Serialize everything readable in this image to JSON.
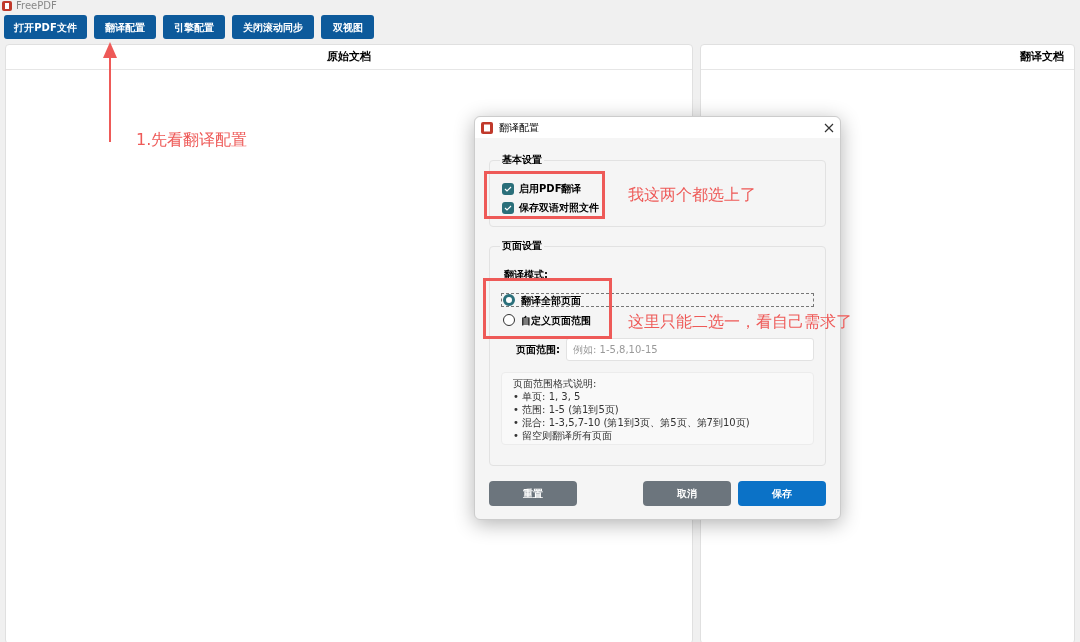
{
  "window": {
    "title": "FreePDF"
  },
  "toolbar": [
    "打开PDF文件",
    "翻译配置",
    "引擎配置",
    "关闭滚动同步",
    "双视图"
  ],
  "panels": [
    {
      "title": "原始文档"
    },
    {
      "title": "翻译文档"
    }
  ],
  "dialog": {
    "title": "翻译配置",
    "basic": {
      "title": "基本设置",
      "options": [
        {
          "label": "启用PDF翻译",
          "checked": true
        },
        {
          "label": "保存双语对照文件",
          "checked": true
        }
      ]
    },
    "pages": {
      "title": "页面设置",
      "mode_label": "翻译模式:",
      "modes": [
        {
          "label": "翻译全部页面",
          "selected": true
        },
        {
          "label": "自定义页面范围",
          "selected": false
        }
      ],
      "range_label": "页面范围:",
      "range_placeholder": "例如: 1-5,8,10-15",
      "help": [
        "页面范围格式说明:",
        "• 单页: 1, 3, 5",
        "• 范围: 1-5 (第1到5页)",
        "• 混合: 1-3,5,7-10 (第1到3页、第5页、第7到10页)",
        "• 留空则翻译所有页面"
      ]
    },
    "buttons": [
      {
        "label": "重置",
        "kind": "secondary"
      },
      {
        "label": "取消",
        "kind": "secondary"
      },
      {
        "label": "保存",
        "kind": "primary"
      }
    ]
  },
  "annotations": [
    "1.先看翻译配置",
    "我这两个都选上了",
    "这里只能二选一，看自己需求了"
  ]
}
